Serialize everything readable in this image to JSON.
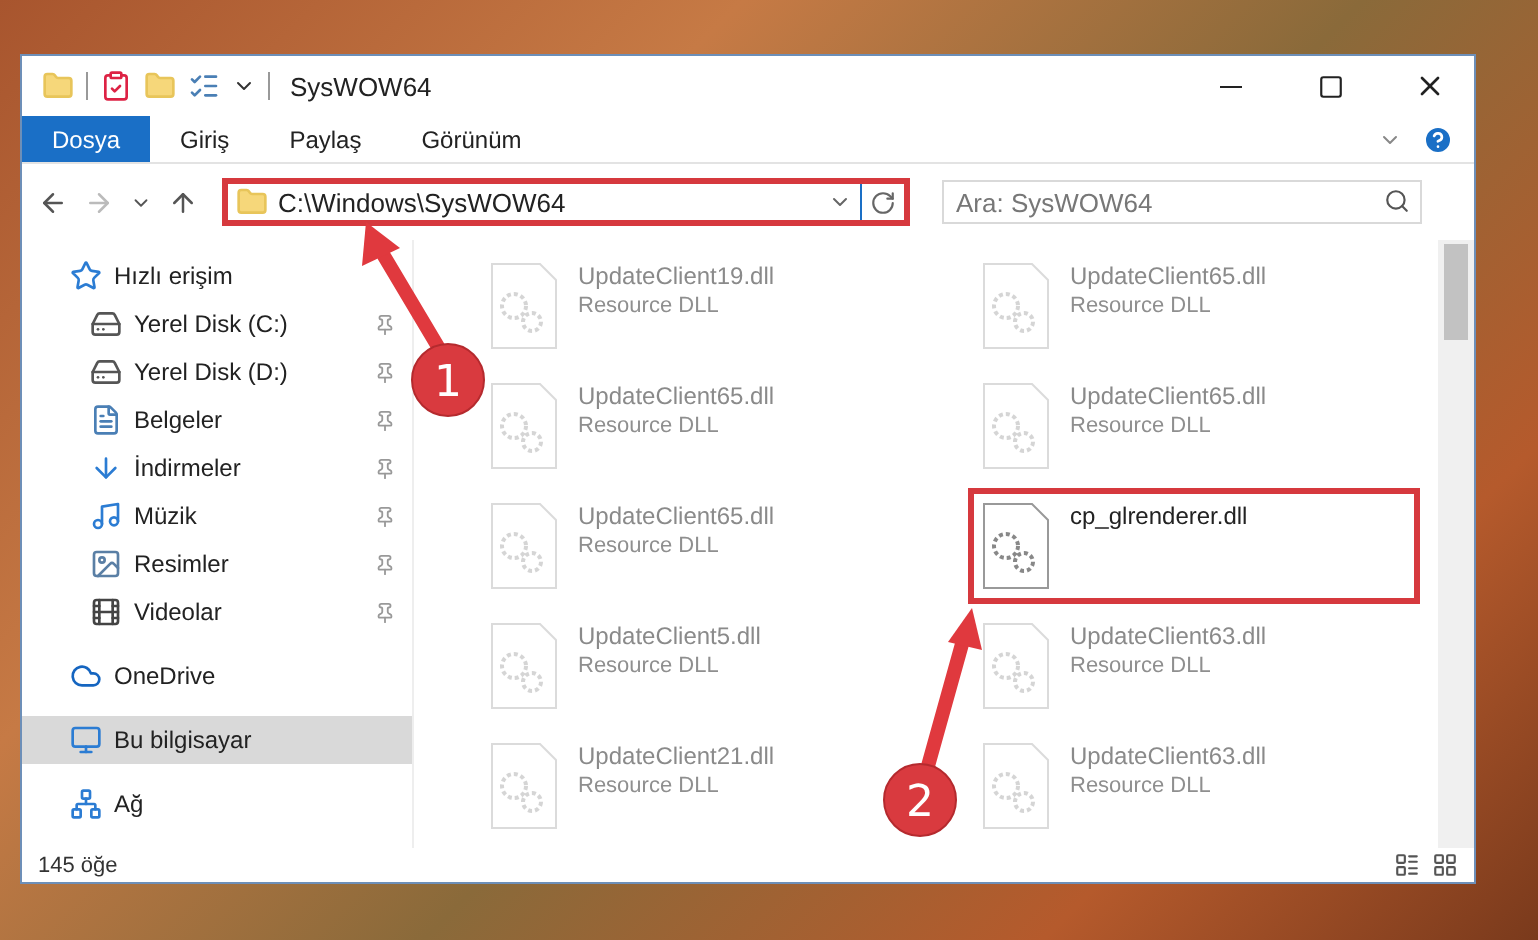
{
  "window": {
    "title": "SysWOW64"
  },
  "ribbon_tabs": [
    {
      "label": "Dosya",
      "selected": true
    },
    {
      "label": "Giriş",
      "selected": false
    },
    {
      "label": "Paylaş",
      "selected": false
    },
    {
      "label": "Görünüm",
      "selected": false
    }
  ],
  "address_bar": {
    "path": "C:\\Windows\\SysWOW64",
    "highlighted": true
  },
  "search": {
    "placeholder": "Ara: SysWOW64"
  },
  "sidebar": {
    "items": [
      {
        "label": "Hızlı erişim",
        "pinned": false,
        "selected": false,
        "indented": false
      },
      {
        "label": "Yerel Disk (C:)",
        "pinned": true,
        "selected": false,
        "indented": true
      },
      {
        "label": "Yerel Disk (D:)",
        "pinned": true,
        "selected": false,
        "indented": true
      },
      {
        "label": "Belgeler",
        "pinned": true,
        "selected": false,
        "indented": true
      },
      {
        "label": "İndirmeler",
        "pinned": true,
        "selected": false,
        "indented": true
      },
      {
        "label": "Müzik",
        "pinned": true,
        "selected": false,
        "indented": true
      },
      {
        "label": "Resimler",
        "pinned": true,
        "selected": false,
        "indented": true
      },
      {
        "label": "Videolar",
        "pinned": true,
        "selected": false,
        "indented": true
      },
      {
        "label": "OneDrive",
        "pinned": false,
        "selected": false,
        "indented": false
      },
      {
        "label": "Bu bilgisayar",
        "pinned": false,
        "selected": true,
        "indented": false
      },
      {
        "label": "Ağ",
        "pinned": false,
        "selected": false,
        "indented": false
      }
    ]
  },
  "files": [
    {
      "name": "UpdateClient19.dll",
      "type": "Resource DLL",
      "dimmed": true,
      "highlighted": false
    },
    {
      "name": "UpdateClient65.dll",
      "type": "Resource DLL",
      "dimmed": true,
      "highlighted": false
    },
    {
      "name": "UpdateClient65.dll",
      "type": "Resource DLL",
      "dimmed": true,
      "highlighted": false
    },
    {
      "name": "UpdateClient65.dll",
      "type": "Resource DLL",
      "dimmed": true,
      "highlighted": false
    },
    {
      "name": "UpdateClient65.dll",
      "type": "Resource DLL",
      "dimmed": true,
      "highlighted": false
    },
    {
      "name": "cp_glrenderer.dll",
      "dimmed": false,
      "highlighted": true
    },
    {
      "name": "UpdateClient5.dll",
      "type": "Resource DLL",
      "dimmed": true,
      "highlighted": false
    },
    {
      "name": "UpdateClient63.dll",
      "type": "Resource DLL",
      "dimmed": true,
      "highlighted": false
    },
    {
      "name": "UpdateClient21.dll",
      "type": "Resource DLL",
      "dimmed": true,
      "highlighted": false
    },
    {
      "name": "UpdateClient63.dll",
      "type": "Resource DLL",
      "dimmed": true,
      "highlighted": false
    }
  ],
  "status_bar": {
    "item_count": "145 öğe"
  },
  "annotations": [
    {
      "number": "1"
    },
    {
      "number": "2"
    }
  ]
}
